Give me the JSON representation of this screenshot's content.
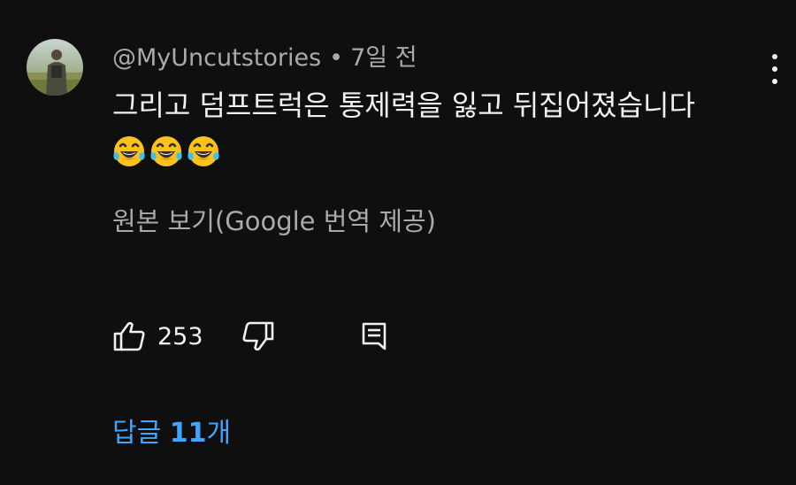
{
  "comment": {
    "author": "@MyUncutstories",
    "separator": "•",
    "time": "7일 전",
    "text": "그리고 덤프트럭은 통제력을 잃고 뒤집어졌습니다",
    "emojis": [
      "laughing-tears-emoji",
      "laughing-tears-emoji",
      "laughing-tears-emoji"
    ],
    "translation_link": "원본 보기(Google 번역 제공)"
  },
  "actions": {
    "like_icon": "thumbs-up-icon",
    "like_count": "253",
    "dislike_icon": "thumbs-down-icon",
    "reply_icon": "comment-icon"
  },
  "replies": {
    "prefix": "답글 ",
    "count": "11",
    "suffix": "개"
  },
  "colors": {
    "background": "#0f0f0f",
    "primary_text": "#f1f1f1",
    "secondary_text": "#aaaaaa",
    "link_blue": "#3ea6ff"
  }
}
